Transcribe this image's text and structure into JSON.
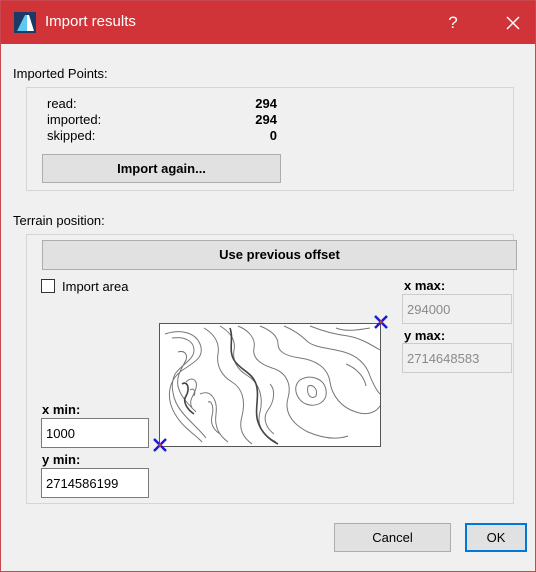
{
  "window": {
    "title": "Import results",
    "help_label": "?"
  },
  "imported_points": {
    "section_label": "Imported Points:",
    "rows": [
      {
        "label": "read:",
        "value": "294"
      },
      {
        "label": "imported:",
        "value": "294"
      },
      {
        "label": "skipped:",
        "value": "0"
      }
    ],
    "import_again_label": "Import again..."
  },
  "terrain": {
    "section_label": "Terrain position:",
    "use_previous_label": "Use previous offset",
    "import_area_label": "Import area",
    "import_area_checked": false,
    "x_max": {
      "label": "x max:",
      "value": "294000"
    },
    "y_max": {
      "label": "y max:",
      "value": "2714648583"
    },
    "x_min": {
      "label": "x min:",
      "value": "1000"
    },
    "y_min": {
      "label": "y min:",
      "value": "2714586199"
    }
  },
  "footer": {
    "cancel_label": "Cancel",
    "ok_label": "OK"
  },
  "colors": {
    "titlebar": "#d13438",
    "marker": "#1a1ad6",
    "ok_border": "#0078d7"
  },
  "icons": {
    "app": "app-logo-icon",
    "close": "close-icon",
    "marker": "x-marker-icon"
  }
}
